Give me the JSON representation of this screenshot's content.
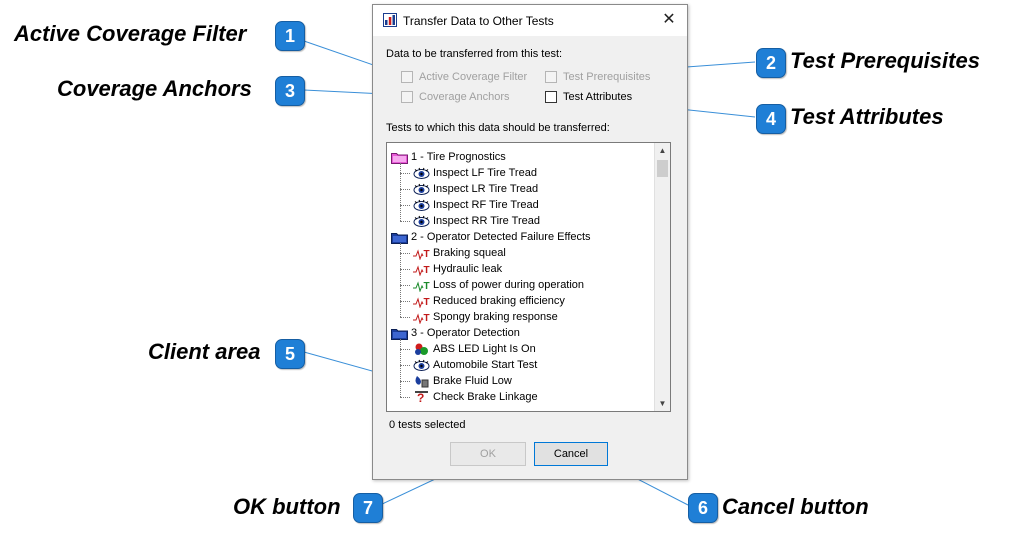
{
  "dialog": {
    "title": "Transfer Data to Other Tests",
    "close_glyph": "✕",
    "data_section_label": "Data to be transferred from this test:",
    "checkboxes": {
      "active_coverage_filter": "Active Coverage Filter",
      "test_prerequisites": "Test Prerequisites",
      "coverage_anchors": "Coverage Anchors",
      "test_attributes": "Test Attributes"
    },
    "tests_section_label": "Tests to which this data should be transferred:",
    "tree": [
      {
        "label": "1 - Tire Prognostics",
        "kind": "folder",
        "icon": "folder-pink-icon"
      },
      {
        "label": "Inspect LF Tire Tread",
        "kind": "child",
        "icon": "eye-icon"
      },
      {
        "label": "Inspect LR Tire Tread",
        "kind": "child",
        "icon": "eye-icon"
      },
      {
        "label": "Inspect RF Tire Tread",
        "kind": "child",
        "icon": "eye-icon"
      },
      {
        "label": "Inspect RR Tire Tread",
        "kind": "child",
        "icon": "eye-icon"
      },
      {
        "label": "2 - Operator Detected Failure Effects",
        "kind": "folder",
        "icon": "folder-blue-icon"
      },
      {
        "label": "Braking squeal",
        "kind": "child",
        "icon": "failure-effect-red-icon"
      },
      {
        "label": "Hydraulic leak",
        "kind": "child",
        "icon": "failure-effect-red-icon"
      },
      {
        "label": "Loss of power during operation",
        "kind": "child",
        "icon": "failure-effect-green-icon"
      },
      {
        "label": "Reduced braking efficiency",
        "kind": "child",
        "icon": "failure-effect-red-icon"
      },
      {
        "label": "Spongy braking response",
        "kind": "child",
        "icon": "failure-effect-red-icon"
      },
      {
        "label": "3 - Operator Detection",
        "kind": "folder",
        "icon": "folder-blue-icon"
      },
      {
        "label": "ABS LED Light Is On",
        "kind": "child",
        "icon": "led-light-icon"
      },
      {
        "label": "Automobile Start Test",
        "kind": "child",
        "icon": "eye-icon"
      },
      {
        "label": "Brake Fluid Low",
        "kind": "child",
        "icon": "fluid-level-icon"
      },
      {
        "label": "Check Brake Linkage",
        "kind": "child",
        "icon": "question-mark-icon"
      }
    ],
    "status_text": "0 tests selected",
    "ok_label": "OK",
    "cancel_label": "Cancel"
  },
  "callouts": [
    {
      "number": "1",
      "label": "Active Coverage Filter"
    },
    {
      "number": "2",
      "label": "Test Prerequisites"
    },
    {
      "number": "3",
      "label": "Coverage Anchors"
    },
    {
      "number": "4",
      "label": "Test Attributes"
    },
    {
      "number": "5",
      "label": "Client area"
    },
    {
      "number": "6",
      "label": "Cancel button"
    },
    {
      "number": "7",
      "label": "OK button"
    }
  ],
  "colors": {
    "badge": "#1f7fd6",
    "callout_line": "#3a8fd8"
  }
}
